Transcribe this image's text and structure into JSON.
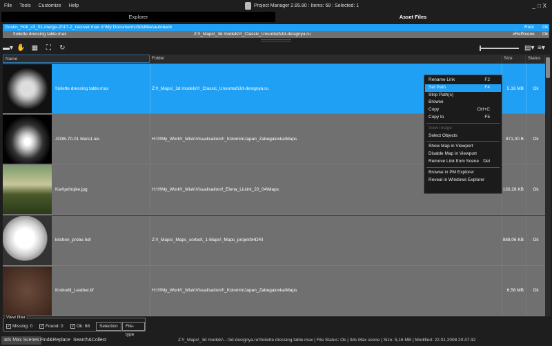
{
  "menu": [
    "File",
    "Tools",
    "Customize",
    "Help"
  ],
  "title": "Project Manager 2.85.80  :  Items: 68  :  Selected: 1",
  "window_controls": [
    "_",
    "□",
    "X"
  ],
  "tabs": [
    {
      "label": "Explorer",
      "active": false
    },
    {
      "label": "Asset Files",
      "active": true
    }
  ],
  "tree": [
    {
      "name": "Gostin_Holl_v3_01-merge-2017-2_recover.max",
      "folder": "d:\\My Documents\\3dsMax\\autoback",
      "type": "Root",
      "status": "Ok",
      "selected": true
    },
    {
      "name": "!toilette dressing  table.max",
      "folder": "Z:\\!_Maps\\_3d models\\!!_Classic_Unsorted\\3d-designya.ru",
      "type": "xRefScene",
      "status": "Ok",
      "selected": false
    }
  ],
  "columns": {
    "name": "Name",
    "folder": "Folder",
    "size": "Size",
    "status": "Status"
  },
  "rows": [
    {
      "name": "!toilette dressing  table.max",
      "folder": "Z:\\!_Maps\\_3d models\\!!_Classic_Unsorted\\3d-designya.ru",
      "size": "5,16 MB",
      "status": "Ok",
      "selected": true,
      "thumb": "furniture"
    },
    {
      "name": "JO36-70-01 Mars1.ies",
      "folder": "H:\\!!!My_Work\\!_Misk\\Visualisation\\!!_Kolomin\\Japan_Zabegalovka\\Maps",
      "size": "871,00 B",
      "status": "Ok",
      "selected": false,
      "thumb": "light"
    },
    {
      "name": "Karl\\prihojke.jpg",
      "folder": "H:\\!!!My_Work\\!_Misk\\Visualisation\\!_Elena_Liu\\int_20_04\\Maps",
      "size": "130,28 KB",
      "status": "Ok",
      "selected": false,
      "thumb": "painting"
    },
    {
      "name": "kitchen_probe.hdr",
      "folder": "Z:\\!_Maps\\_Maps_sorted\\_1-Maps\\_Maps_projekt\\HDRI",
      "size": "988,06 KB",
      "status": "Ok",
      "selected": false,
      "thumb": "sphere"
    },
    {
      "name": "Krokodil_Leather.tif",
      "folder": "H:\\!!!My_Work\\!_Misk\\Visualisation\\!!_Kolomin\\Japan_Zabegalovka\\Maps",
      "size": "6,56 MB",
      "status": "Ok",
      "selected": false,
      "thumb": "leather"
    }
  ],
  "context_menu": [
    [
      {
        "label": "Rename Link",
        "key": "F2"
      },
      {
        "label": "Set Path",
        "key": "F4",
        "highlight": true
      },
      {
        "label": "Strip Path(s)"
      },
      {
        "label": "Browse"
      },
      {
        "label": "Copy",
        "key": "Ctrl+C"
      },
      {
        "label": "Copy to",
        "key": "F5"
      }
    ],
    [
      {
        "label": "View Image",
        "disabled": true
      },
      {
        "label": "Select Objects"
      }
    ],
    [
      {
        "label": "Show Map in Viewport"
      },
      {
        "label": "Disable Map in Viewport"
      },
      {
        "label": "Remove Link from Scene",
        "key": "Del"
      }
    ],
    [
      {
        "label": "Browse in PM Explorer"
      },
      {
        "label": "Reveal in Windows Explorer"
      }
    ]
  ],
  "view_filter": {
    "legend": "View filter",
    "missing": "Missing: 0",
    "found": "Found: 0",
    "ok": "Ok: 68",
    "selection": "Selection",
    "filetype": "File-type"
  },
  "bottom_tabs": [
    "3ds Max Scenes",
    "Find&Replace",
    "Search&Collect"
  ],
  "status_bar": "Z:\\!_Maps\\_3d models\\...\\3d-designya.ru\\!toilette dressing  table.max | File Status: Ok | 3ds Max scene | Size: 5,16 MB | Modified: 22.01.2008 20:47:32",
  "colors": {
    "accent": "#1fa0f5",
    "row_bg": "#707070",
    "background": "#1e1e1e"
  }
}
